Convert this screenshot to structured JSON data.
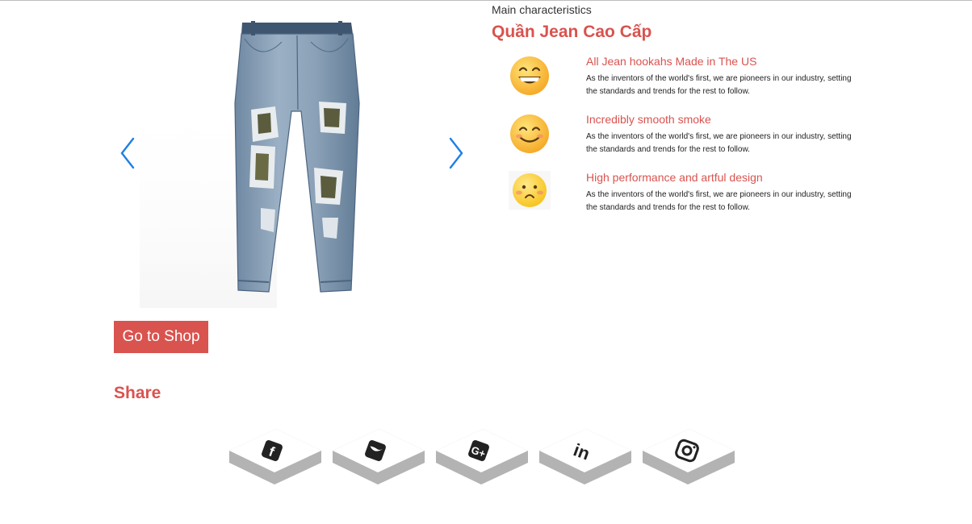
{
  "carousel": {
    "prev_label": "previous",
    "next_label": "next",
    "accent": "#1e7fe6"
  },
  "actions": {
    "shop_label": "Go to Shop"
  },
  "share": {
    "title": "Share",
    "networks": [
      {
        "id": "facebook",
        "icon": "facebook-icon"
      },
      {
        "id": "twitter",
        "icon": "twitter-icon"
      },
      {
        "id": "google-plus",
        "icon": "google-plus-icon"
      },
      {
        "id": "linkedin",
        "icon": "linkedin-icon"
      },
      {
        "id": "instagram",
        "icon": "instagram-icon"
      }
    ]
  },
  "product": {
    "section_label": "Main characteristics",
    "title": "Quần Jean Cao Cấp"
  },
  "features": [
    {
      "icon": "grinning-emoji-icon",
      "title": "All Jean hookahs Made in The US",
      "text": "As the inventors of the world's first, we are pioneers in our industry, setting the standards and trends for the rest to follow."
    },
    {
      "icon": "smiling-emoji-icon",
      "title": "Incredibly smooth smoke",
      "text": "As the inventors of the world's first, we are pioneers in our industry, setting the standards and trends for the rest to follow."
    },
    {
      "icon": "flushed-emoji-icon",
      "title": "High performance and artful design",
      "text": "As the inventors of the world's first, we are pioneers in our industry, setting the standards and trends for the rest to follow."
    }
  ],
  "colors": {
    "accent": "#d9534f",
    "arrow": "#1e7fe6",
    "denim": "#7f98b0",
    "tile_side": "#b3b3b3"
  }
}
